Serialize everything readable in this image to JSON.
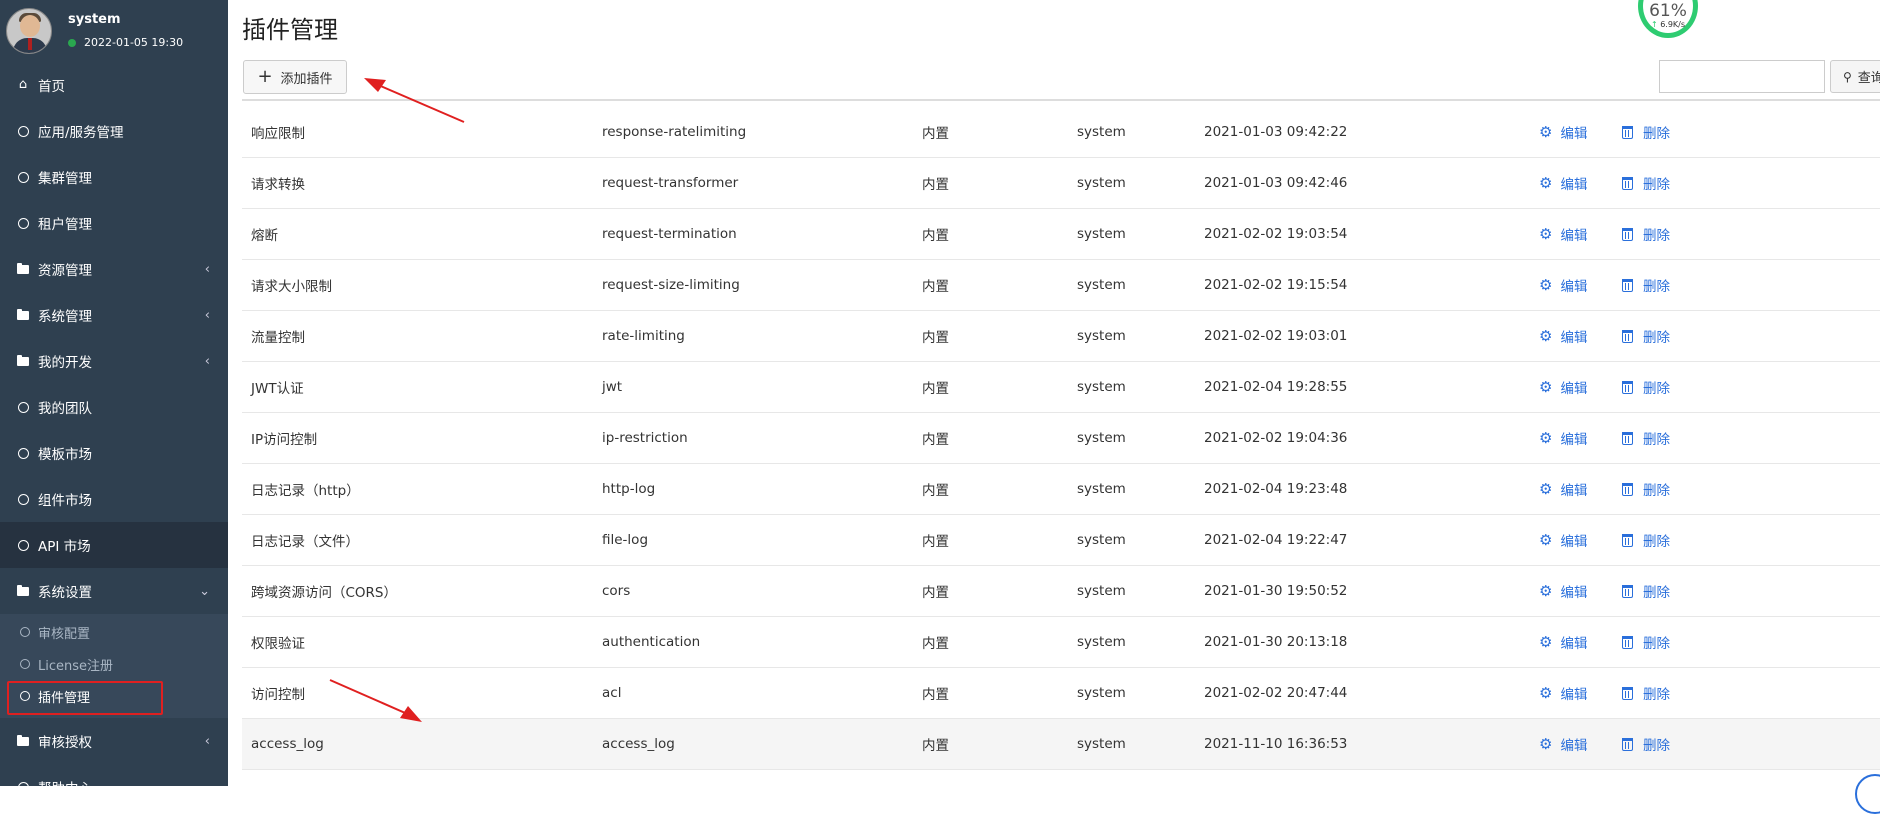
{
  "user": {
    "name": "system",
    "datetime": "2022-01-05 19:30"
  },
  "sidebar": {
    "items": [
      {
        "label": "首页",
        "icon": "home-icon"
      },
      {
        "label": "应用/服务管理",
        "icon": "circle-icon"
      },
      {
        "label": "集群管理",
        "icon": "circle-icon"
      },
      {
        "label": "租户管理",
        "icon": "circle-icon"
      },
      {
        "label": "资源管理",
        "icon": "folder-icon",
        "chevron": "‹"
      },
      {
        "label": "系统管理",
        "icon": "folder-icon",
        "chevron": "‹"
      },
      {
        "label": "我的开发",
        "icon": "folder-icon",
        "chevron": "‹"
      },
      {
        "label": "我的团队",
        "icon": "circle-icon"
      },
      {
        "label": "模板市场",
        "icon": "circle-icon"
      },
      {
        "label": "组件市场",
        "icon": "circle-icon"
      },
      {
        "label": "API 市场",
        "icon": "circle-icon"
      },
      {
        "label": "系统设置",
        "icon": "folder-icon",
        "chevron": "⌄"
      }
    ],
    "sub_items": [
      {
        "label": "审核配置"
      },
      {
        "label": "License注册"
      },
      {
        "label": "插件管理"
      }
    ],
    "tail_items": [
      {
        "label": "审核授权",
        "icon": "folder-icon",
        "chevron": "‹"
      },
      {
        "label": "帮助中心",
        "icon": "circle-icon"
      }
    ]
  },
  "page": {
    "title": "插件管理",
    "add_button": "添加插件",
    "search_placeholder": "",
    "search_button": "查询"
  },
  "monitor": {
    "percent": "61%",
    "speed": "6.9K/s"
  },
  "table": {
    "edit_label": "编辑",
    "delete_label": "删除",
    "rows": [
      {
        "name": "响应限制",
        "code": "response-ratelimiting",
        "type": "内置",
        "user": "system",
        "time": "2021-01-03 09:42:22"
      },
      {
        "name": "请求转换",
        "code": "request-transformer",
        "type": "内置",
        "user": "system",
        "time": "2021-01-03 09:42:46"
      },
      {
        "name": "熔断",
        "code": "request-termination",
        "type": "内置",
        "user": "system",
        "time": "2021-02-02 19:03:54"
      },
      {
        "name": "请求大小限制",
        "code": "request-size-limiting",
        "type": "内置",
        "user": "system",
        "time": "2021-02-02 19:15:54"
      },
      {
        "name": "流量控制",
        "code": "rate-limiting",
        "type": "内置",
        "user": "system",
        "time": "2021-02-02 19:03:01"
      },
      {
        "name": "JWT认证",
        "code": "jwt",
        "type": "内置",
        "user": "system",
        "time": "2021-02-04 19:28:55"
      },
      {
        "name": "IP访问控制",
        "code": "ip-restriction",
        "type": "内置",
        "user": "system",
        "time": "2021-02-02 19:04:36"
      },
      {
        "name": "日志记录（http）",
        "code": "http-log",
        "type": "内置",
        "user": "system",
        "time": "2021-02-04 19:23:48"
      },
      {
        "name": "日志记录（文件）",
        "code": "file-log",
        "type": "内置",
        "user": "system",
        "time": "2021-02-04 19:22:47"
      },
      {
        "name": "跨域资源访问（CORS）",
        "code": "cors",
        "type": "内置",
        "user": "system",
        "time": "2021-01-30 19:50:52"
      },
      {
        "name": "权限验证",
        "code": "authentication",
        "type": "内置",
        "user": "system",
        "time": "2021-01-30 20:13:18"
      },
      {
        "name": "访问控制",
        "code": "acl",
        "type": "内置",
        "user": "system",
        "time": "2021-02-02 20:47:44"
      },
      {
        "name": "access_log",
        "code": "access_log",
        "type": "内置",
        "user": "system",
        "time": "2021-11-10 16:36:53"
      }
    ]
  },
  "colors": {
    "sidebar_bg": "#2f4050",
    "link": "#2a6fdb",
    "annotation": "#e02020",
    "status_online": "#2aa84f"
  }
}
